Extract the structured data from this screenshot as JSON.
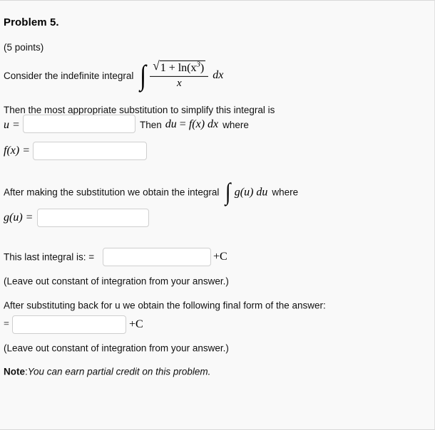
{
  "problem": {
    "title": "Problem 5.",
    "points": "(5 points)"
  },
  "statements": {
    "consider_prefix": "Consider the indefinite integral",
    "integrand": {
      "numerator_sqrt_inner": "1 + ln(x",
      "numerator_exponent": "3",
      "numerator_close": ")",
      "denominator": "x",
      "differential": "dx"
    },
    "substitution_prompt": "Then the most appropriate substitution to simplify this integral is",
    "u_label": "u =",
    "then_du_text": "Then",
    "du_expr_lhs": "du",
    "du_expr_eq": "=",
    "du_expr_rhs": "f(x) dx",
    "where_1": "where",
    "fx_label": "f(x) =",
    "after_sub_prefix": "After making the substitution we obtain the integral",
    "gu_du_expr": "g(u) du",
    "where_2": "where",
    "gu_label": "g(u) =",
    "last_integral_label": "This last integral is:  =",
    "plus_c_1": "+C",
    "leave_out_1": "(Leave out constant of integration from your answer.)",
    "after_substituting_back": "After substituting back for u we obtain the following final form of the answer:",
    "final_eq_label": "=",
    "plus_c_2": "+C",
    "leave_out_2": "(Leave out constant of integration from your answer.)",
    "note_label": "Note",
    "note_sep": ": ",
    "note_text": "You can earn partial credit on this problem."
  },
  "inputs": {
    "u_value": "",
    "u_placeholder": "",
    "fx_value": "",
    "fx_placeholder": "",
    "gu_value": "",
    "gu_placeholder": "",
    "last_integral_value": "",
    "last_integral_placeholder": "",
    "final_answer_value": "",
    "final_answer_placeholder": ""
  },
  "glyphs": {
    "integral": "∫",
    "radical": "√",
    "equals": "=",
    "plus": "+"
  },
  "colors": {
    "page_background": "#f9f9f9",
    "text": "#111111",
    "input_background": "#ffffff",
    "input_border": "#cfcfcf",
    "page_border": "#d8d8d8"
  }
}
